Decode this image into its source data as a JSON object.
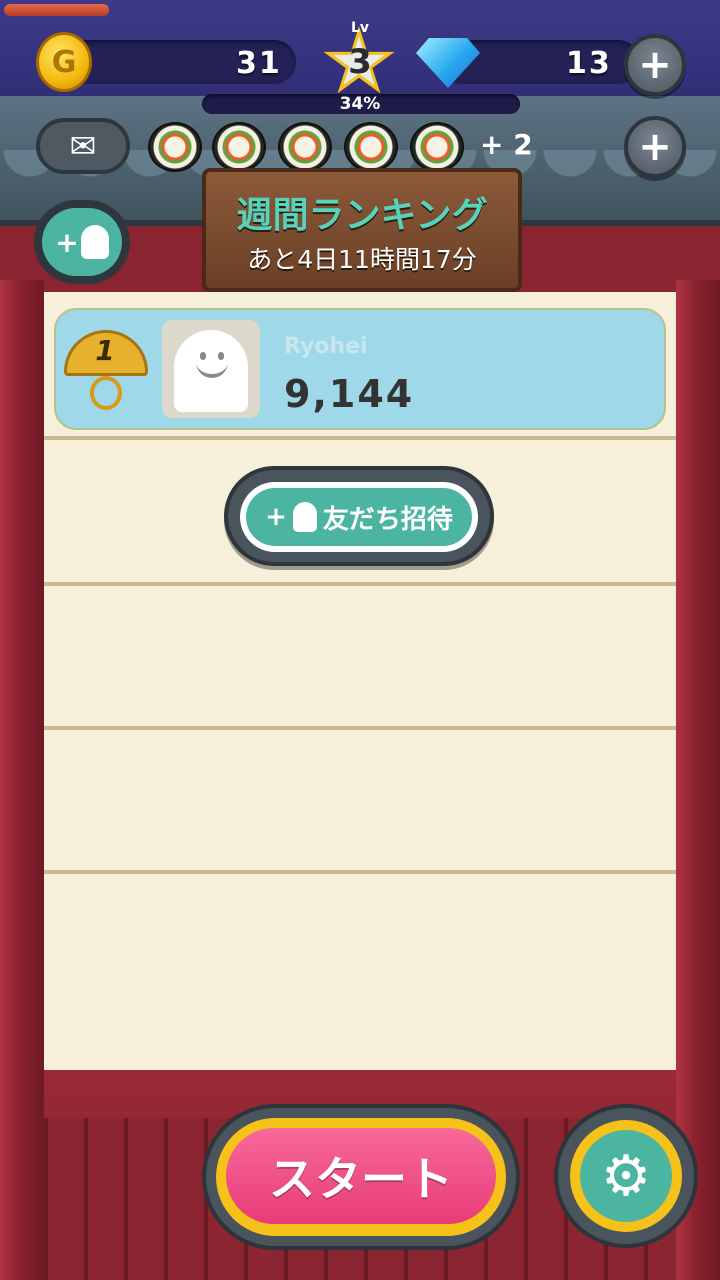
{
  "hud": {
    "coin_symbol": "G",
    "coins": "31",
    "level_label": "Lv",
    "level": "3",
    "gems": "13",
    "xp_percent_label": "34%",
    "xp_fraction": 0.34,
    "extra_sushi": "+  2"
  },
  "icons": {
    "plus": "+",
    "mail": "✉",
    "gear": "⚙"
  },
  "banner": {
    "title": "週間ランキング",
    "subtitle": "あと4日11時間17分"
  },
  "ranking": [
    {
      "rank": "1",
      "name": "Ryohei",
      "score": "9,144"
    }
  ],
  "buttons": {
    "invite_label": "友だち招待",
    "start_label": "スタート"
  },
  "colors": {
    "accent_teal": "#4bb5a1",
    "start_pink": "#e83b78",
    "gold": "#f6c21a"
  }
}
